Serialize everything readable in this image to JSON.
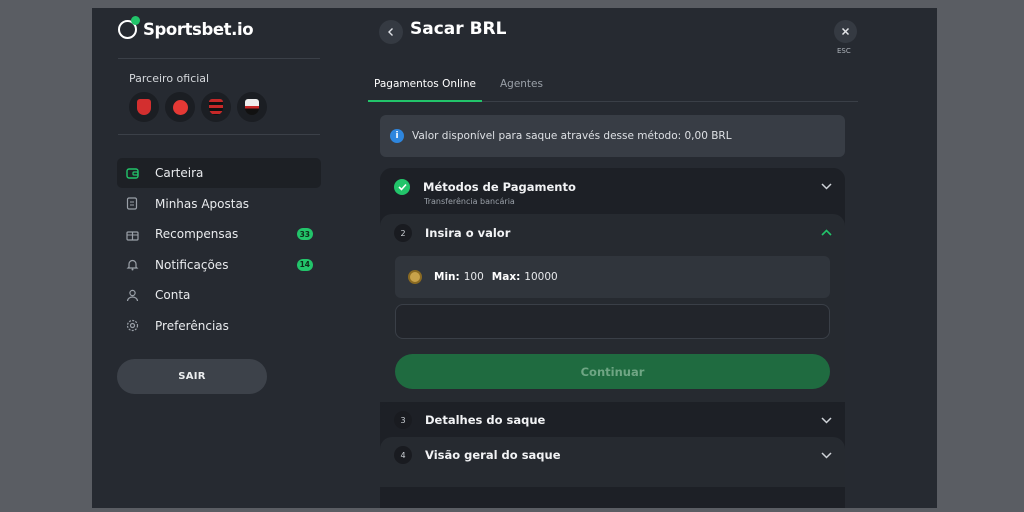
{
  "brand": {
    "name": "Sportsbet.io"
  },
  "sidebar": {
    "partner_label": "Parceiro oficial",
    "partners": [
      {
        "icon": "arsenal-crest",
        "color": "#d32f2f"
      },
      {
        "icon": "southampton-crest",
        "color": "#e53935"
      },
      {
        "icon": "flamengo-crest",
        "color": "#c62828"
      },
      {
        "icon": "sao-paulo-crest",
        "color": "#eeeeee"
      }
    ],
    "items": [
      {
        "label": "Carteira",
        "icon": "wallet-icon",
        "active": true
      },
      {
        "label": "Minhas Apostas",
        "icon": "betslip-icon"
      },
      {
        "label": "Recompensas",
        "icon": "gift-icon",
        "badge": "33"
      },
      {
        "label": "Notificações",
        "icon": "bell-icon",
        "badge": "14"
      },
      {
        "label": "Conta",
        "icon": "user-icon"
      },
      {
        "label": "Preferências",
        "icon": "gear-icon"
      }
    ],
    "logout_label": "SAIR"
  },
  "header": {
    "title": "Sacar BRL",
    "esc_label": "ESC"
  },
  "tabs": [
    {
      "label": "Pagamentos Online",
      "active": true
    },
    {
      "label": "Agentes",
      "active": false
    }
  ],
  "info": {
    "icon": "info-icon",
    "text": "Valor disponível para saque através desse método: 0,00 BRL"
  },
  "steps": {
    "payment_method": {
      "title": "Métodos de Pagamento",
      "subtitle": "Transferência bancária"
    },
    "amount": {
      "number": "2",
      "title": "Insira o valor",
      "min_label": "Min:",
      "min_value": "100",
      "max_label": "Max:",
      "max_value": "10000",
      "input_value": "",
      "continue_label": "Continuar"
    },
    "details": {
      "number": "3",
      "title": "Detalhes do saque"
    },
    "overview": {
      "number": "4",
      "title": "Visão geral do saque"
    }
  },
  "colors": {
    "accent": "#22c46a",
    "info": "#2e86de",
    "panel": "#262a31"
  }
}
